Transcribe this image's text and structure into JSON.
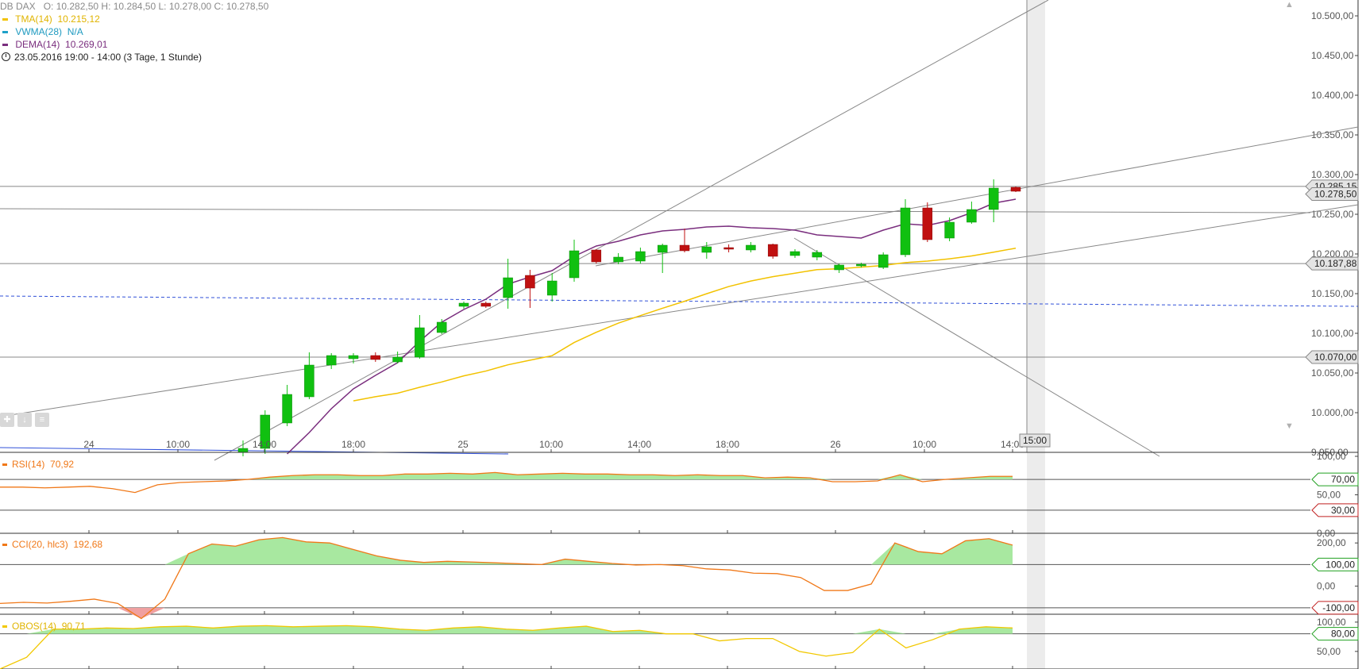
{
  "legend": {
    "instrument": "DB DAX",
    "ohlc": "O: 10.282,50  H: 10.284,50  L: 10.278,00  C: 10.278,50",
    "tma": {
      "label": "TMA(14)",
      "value": "10.215,12",
      "color": "#f2c200"
    },
    "vwma": {
      "label": "VWMA(28)",
      "value": "N/A",
      "color": "#1ea0c8"
    },
    "dema": {
      "label": "DEMA(14)",
      "value": "10.269,01",
      "color": "#7a2e7e"
    },
    "period": "23.05.2016 19:00 - 14:00 (3 Tage, 1 Stunde)"
  },
  "toolbar": {
    "icons": [
      "move-icon",
      "download-icon",
      "menu-icon"
    ]
  },
  "chart_data": [
    {
      "type": "candlestick",
      "ylim": [
        9950,
        10520
      ],
      "y_ticks": [
        "10.500,00",
        "10.450,00",
        "10.400,00",
        "10.350,00",
        "10.300,00",
        "10.250,00",
        "10.200,00",
        "10.150,00",
        "10.100,00",
        "10.050,00",
        "10.000,00",
        "9.950,00"
      ],
      "x_ticks": [
        "24",
        "10:00",
        "14:00",
        "18:00",
        "25",
        "10:00",
        "14:00",
        "18:00",
        "26",
        "10:00",
        "14:00"
      ],
      "crosshair_label": "15:00",
      "price_labels": [
        "10.285,15",
        "10.278,50",
        "10.187,88",
        "10.070,00"
      ],
      "candles": [
        {
          "o": 9950,
          "h": 9965,
          "l": 9945,
          "c": 9955
        },
        {
          "o": 9955,
          "h": 10003,
          "l": 9948,
          "c": 9997
        },
        {
          "o": 9987,
          "h": 10035,
          "l": 9983,
          "c": 10023
        },
        {
          "o": 10020,
          "h": 10076,
          "l": 10017,
          "c": 10060
        },
        {
          "o": 10060,
          "h": 10075,
          "l": 10055,
          "c": 10072
        },
        {
          "o": 10068,
          "h": 10075,
          "l": 10062,
          "c": 10072
        },
        {
          "o": 10072,
          "h": 10076,
          "l": 10064,
          "c": 10067
        },
        {
          "o": 10064,
          "h": 10077,
          "l": 10062,
          "c": 10070
        },
        {
          "o": 10070,
          "h": 10123,
          "l": 10068,
          "c": 10107
        },
        {
          "o": 10101,
          "h": 10118,
          "l": 10099,
          "c": 10114
        },
        {
          "o": 10134,
          "h": 10140,
          "l": 10131,
          "c": 10138
        },
        {
          "o": 10138,
          "h": 10140,
          "l": 10132,
          "c": 10134
        },
        {
          "o": 10145,
          "h": 10194,
          "l": 10131,
          "c": 10170
        },
        {
          "o": 10173,
          "h": 10180,
          "l": 10132,
          "c": 10157
        },
        {
          "o": 10148,
          "h": 10176,
          "l": 10140,
          "c": 10166
        },
        {
          "o": 10170,
          "h": 10218,
          "l": 10165,
          "c": 10204
        },
        {
          "o": 10205,
          "h": 10206,
          "l": 10188,
          "c": 10190
        },
        {
          "o": 10190,
          "h": 10201,
          "l": 10187,
          "c": 10196
        },
        {
          "o": 10191,
          "h": 10208,
          "l": 10188,
          "c": 10203
        },
        {
          "o": 10202,
          "h": 10213,
          "l": 10176,
          "c": 10211
        },
        {
          "o": 10211,
          "h": 10232,
          "l": 10202,
          "c": 10204
        },
        {
          "o": 10202,
          "h": 10215,
          "l": 10194,
          "c": 10209
        },
        {
          "o": 10208,
          "h": 10212,
          "l": 10202,
          "c": 10206
        },
        {
          "o": 10205,
          "h": 10215,
          "l": 10202,
          "c": 10211
        },
        {
          "o": 10212,
          "h": 10213,
          "l": 10194,
          "c": 10197
        },
        {
          "o": 10198,
          "h": 10206,
          "l": 10195,
          "c": 10203
        },
        {
          "o": 10196,
          "h": 10205,
          "l": 10192,
          "c": 10202
        },
        {
          "o": 10180,
          "h": 10188,
          "l": 10176,
          "c": 10186
        },
        {
          "o": 10186,
          "h": 10189,
          "l": 10183,
          "c": 10187
        },
        {
          "o": 10183,
          "h": 10202,
          "l": 10181,
          "c": 10199
        },
        {
          "o": 10199,
          "h": 10269,
          "l": 10196,
          "c": 10258
        },
        {
          "o": 10258,
          "h": 10265,
          "l": 10215,
          "c": 10218
        },
        {
          "o": 10220,
          "h": 10246,
          "l": 10216,
          "c": 10240
        },
        {
          "o": 10240,
          "h": 10266,
          "l": 10238,
          "c": 10256
        },
        {
          "o": 10256,
          "h": 10294,
          "l": 10240,
          "c": 10283
        },
        {
          "o": 10284,
          "h": 10285,
          "l": 10278,
          "c": 10279
        }
      ],
      "tma": [
        null,
        null,
        null,
        null,
        null,
        null,
        null,
        null,
        null,
        null,
        null,
        null,
        null,
        null,
        null,
        null,
        null,
        null,
        null,
        null,
        null,
        null,
        null,
        null,
        null,
        null,
        null,
        null,
        null,
        null,
        null,
        null,
        null,
        null,
        null,
        null
      ],
      "dema": [
        null,
        null,
        9948,
        9975,
        10005,
        10030,
        10047,
        10063,
        10090,
        10114,
        10130,
        10143,
        10162,
        10171,
        10179,
        10197,
        10210,
        10216,
        10224,
        10229,
        10231,
        10234,
        10235,
        10233,
        10232,
        10230,
        10224,
        10222,
        10220,
        10230,
        10238,
        10236,
        10242,
        10252,
        10264,
        10269
      ]
    },
    {
      "type": "line",
      "name": "RSI(14)",
      "value": "70,92",
      "color": "#f07818",
      "y_ticks": [
        "100,00",
        "50,00",
        "0,00"
      ],
      "levels": [
        "70,00",
        "30,00"
      ],
      "values": [
        60,
        60,
        59,
        60,
        61,
        58,
        53,
        63,
        66,
        67,
        68,
        70,
        73,
        75,
        76,
        76,
        75,
        75,
        77,
        77,
        78,
        77,
        79,
        76,
        77,
        78,
        77,
        77,
        76,
        76,
        75,
        76,
        75,
        75,
        72,
        73,
        72,
        67,
        67,
        68,
        76,
        67,
        70,
        72,
        74,
        74
      ]
    },
    {
      "type": "line",
      "name": "CCI(20, hlc3)",
      "value": "192,68",
      "color": "#f07818",
      "y_ticks": [
        "200,00",
        "0,00"
      ],
      "levels": [
        "100,00",
        "-100,00"
      ],
      "values": [
        -80,
        -75,
        -78,
        -70,
        -60,
        -80,
        -150,
        -60,
        150,
        195,
        185,
        215,
        225,
        205,
        200,
        170,
        140,
        120,
        110,
        115,
        112,
        108,
        104,
        100,
        125,
        115,
        105,
        98,
        100,
        95,
        80,
        75,
        60,
        58,
        40,
        -20,
        -20,
        10,
        200,
        160,
        150,
        210,
        220,
        190
      ]
    },
    {
      "type": "line",
      "name": "OBOS(14)",
      "value": "90,71",
      "color": "#f2c800",
      "y_ticks": [
        "100,00",
        "50,00"
      ],
      "levels": [
        "80,00"
      ],
      "values": [
        20,
        40,
        88,
        88,
        90,
        89,
        92,
        93,
        90,
        93,
        94,
        92,
        93,
        94,
        92,
        88,
        86,
        90,
        92,
        88,
        86,
        90,
        93,
        84,
        86,
        80,
        80,
        68,
        72,
        72,
        50,
        42,
        48,
        88,
        56,
        70,
        88,
        92,
        90
      ]
    }
  ]
}
